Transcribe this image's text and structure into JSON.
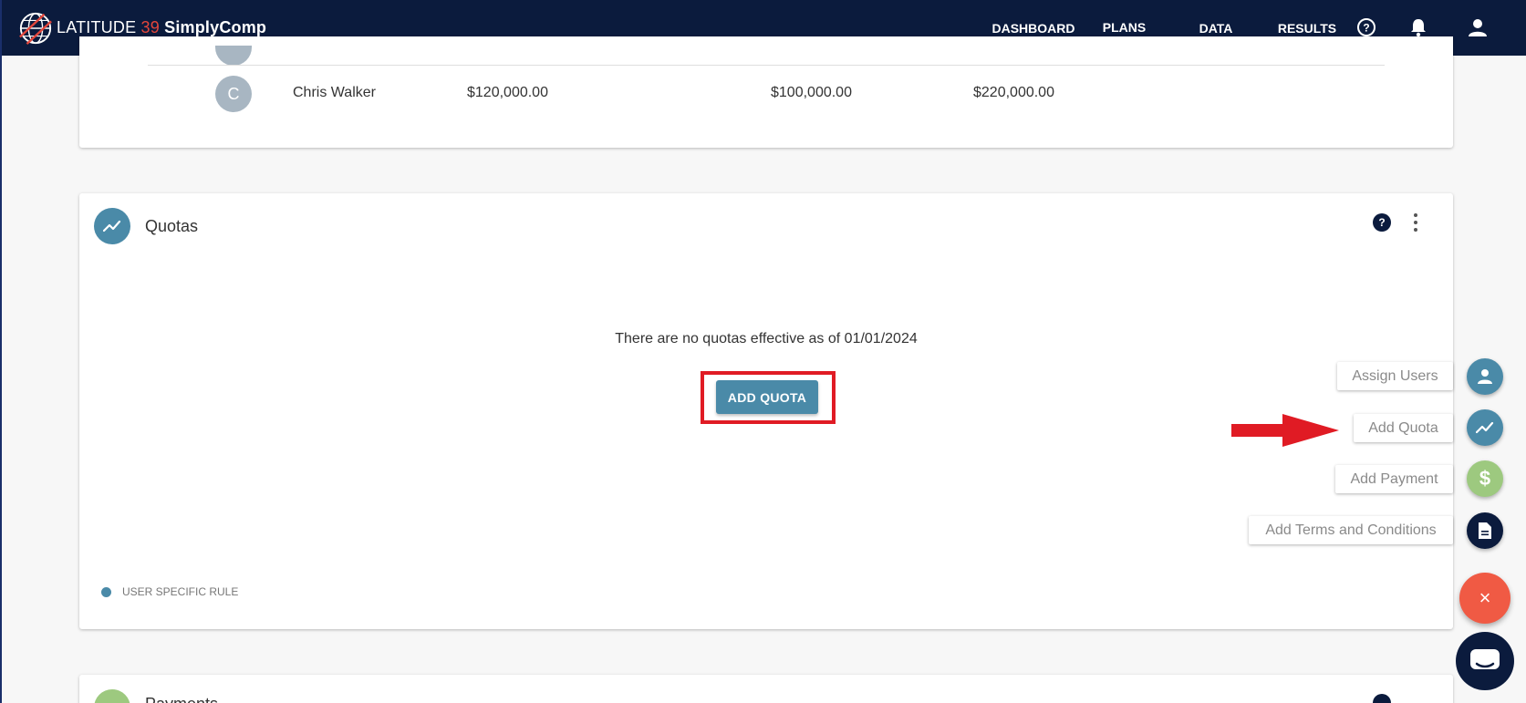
{
  "header": {
    "brand_part1": "LATITUDE ",
    "brand_num": "39",
    "brand_part2": " SimplyComp",
    "nav": [
      "DASHBOARD",
      "PLANS",
      "DATA",
      "RESULTS"
    ],
    "active_nav": "PLANS"
  },
  "users_table": {
    "row": {
      "initial": "C",
      "name": "Chris Walker",
      "col1": "$120,000.00",
      "col2": "$100,000.00",
      "col3": "$220,000.00"
    }
  },
  "quotas": {
    "title": "Quotas",
    "help": "?",
    "empty_message": "There are no quotas effective as of 01/01/2024",
    "add_button": "ADD QUOTA",
    "footer_note": "USER SPECIFIC RULE"
  },
  "payments": {
    "title": "Payments"
  },
  "speed_dial": {
    "assign_users": "Assign Users",
    "add_quota": "Add Quota",
    "add_payment": "Add Payment",
    "add_terms": "Add Terms and Conditions",
    "close": "×"
  },
  "colors": {
    "navy": "#0b1b3d",
    "teal": "#4a8aa8",
    "green": "#9dc97f",
    "accent_red": "#e01b24",
    "fab_orange": "#f05a44"
  }
}
